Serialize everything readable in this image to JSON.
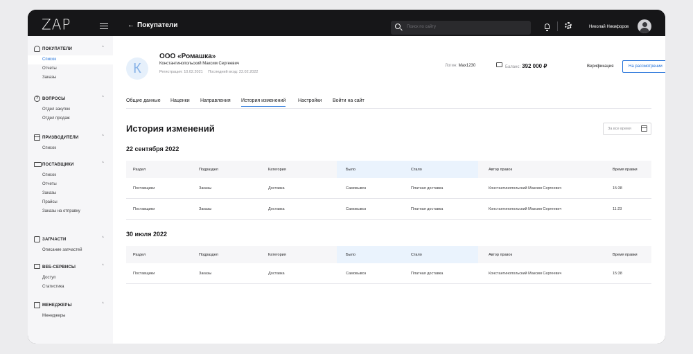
{
  "topbar": {
    "logo": "ZAP",
    "back_label": "Покупатели",
    "search_placeholder": "Поиск по сайту",
    "username": "Николай Никифоров"
  },
  "sidebar": {
    "sections": [
      {
        "title": "ПОКУПАТЕЛИ",
        "icon": "user-icon",
        "items": [
          "Список",
          "Отчеты",
          "Заказы"
        ],
        "active": 0
      },
      {
        "title": "ВОПРОСЫ",
        "icon": "question-icon",
        "items": [
          "Отдел закупок",
          "Отдел продаж"
        ]
      },
      {
        "title": "ПРИЗВОДИТЕЛИ",
        "icon": "factory-icon",
        "items": [
          "Список"
        ]
      },
      {
        "title": "ПОСТАВЩИКИ",
        "icon": "truck-icon",
        "items": [
          "Список",
          "Отчеты",
          "Заказы",
          "Прайсы",
          "Заказы на отправку"
        ]
      },
      {
        "title": "ЗАПЧАСТИ",
        "icon": "parts-icon",
        "items": [
          "Описание запчастей"
        ]
      },
      {
        "title": "ВЕБ-СЕРВИСЫ",
        "icon": "monitor-icon",
        "items": [
          "Доступ",
          "Статистика"
        ]
      },
      {
        "title": "МЕНЕДЖЕРЫ",
        "icon": "id-card-icon",
        "items": [
          "Менеджеры"
        ]
      }
    ]
  },
  "customer": {
    "initial": "К",
    "name": "ООО «Ромашка»",
    "person": "Константинопольский Максим Сергеевич",
    "registration": "Регистрация: 10.02.2021",
    "last_login": "Последний вход: 22.02.2022",
    "login_label": "Логин:",
    "login_value": "Мах1230",
    "balance_label": "Баланс:",
    "balance_value": "392 000 ₽",
    "verification_label": "Верификация",
    "verification_status": "На рассмотрении"
  },
  "tabs": [
    "Общие данные",
    "Наценки",
    "Направления",
    "История изменений",
    "Настройки",
    "Войти на сайт"
  ],
  "active_tab": 3,
  "history": {
    "title": "История изменений",
    "period": "За все время",
    "columns": [
      "Раздел",
      "Подраздел",
      "Категория",
      "Было",
      "Стало",
      "Автор правок",
      "Время правки"
    ],
    "groups": [
      {
        "date": "22 сентября 2022",
        "rows": [
          [
            "Поставщики",
            "Заказы",
            "Доставка",
            "Самовывоз",
            "Платная доставка",
            "Константинопольский Максим Сергеевич",
            "15:38"
          ],
          [
            "Поставщики",
            "Заказы",
            "Доставка",
            "Самовывоз",
            "Платная доставка",
            "Константинопольский Максим Сергеевич",
            "11:23"
          ]
        ]
      },
      {
        "date": "30 июля 2022",
        "rows": [
          [
            "Поставщики",
            "Заказы",
            "Доставка",
            "Самовывоз",
            "Платная доставка",
            "Константинопольский Максим Сергеевич",
            "15:38"
          ]
        ]
      }
    ]
  },
  "colors": {
    "accent": "#1e6fd9",
    "topbar": "#161618",
    "sidebar": "#f6f6f8",
    "highlight": "#eaf3fd"
  }
}
